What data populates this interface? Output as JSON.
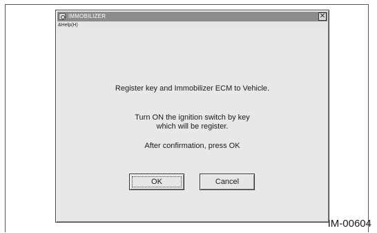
{
  "window": {
    "title": "IMMOBILIZER",
    "close_glyph": "✕"
  },
  "menu": {
    "help_label": "&Help(H)"
  },
  "message": {
    "main": "Register key and Immobilizer ECM to Vehicle.",
    "instruction_line1": "Turn ON the ignition switch by key",
    "instruction_line2": "which will be register.",
    "confirm": "After confirmation, press OK"
  },
  "buttons": {
    "ok_label": "OK",
    "cancel_label": "Cancel"
  },
  "figure": {
    "caption": "IM-00604"
  }
}
